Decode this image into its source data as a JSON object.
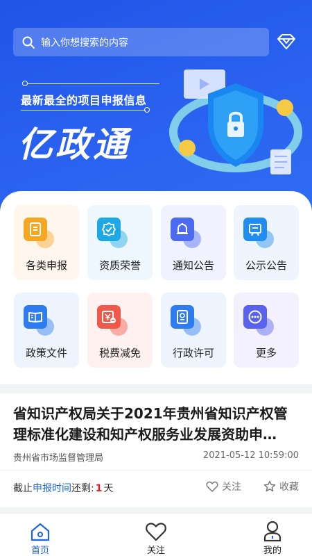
{
  "search": {
    "placeholder": "输入你想搜索的内容",
    "icon": "search-icon"
  },
  "header": {
    "vip_icon": "diamond-icon"
  },
  "banner": {
    "slogan": "最新最全的项目申报信息",
    "brand": "亿政通"
  },
  "grid": [
    {
      "label": "各类申报",
      "icon": "document-icon",
      "color": "#f5a623",
      "bg": "#fff7ee"
    },
    {
      "label": "资质荣誉",
      "icon": "badge-check-icon",
      "color": "#1ea8e6",
      "bg": "#eef6fe"
    },
    {
      "label": "通知公告",
      "icon": "bell-icon",
      "color": "#4d6bf0",
      "bg": "#f1f2ff"
    },
    {
      "label": "公示公告",
      "icon": "board-icon",
      "color": "#1f8ef0",
      "bg": "#eef5fe"
    },
    {
      "label": "政策文件",
      "icon": "book-icon",
      "color": "#2f7cf0",
      "bg": "#eef4fe"
    },
    {
      "label": "税费减免",
      "icon": "yen-icon",
      "color": "#f0584a",
      "bg": "#fff1ef"
    },
    {
      "label": "行政许可",
      "icon": "certificate-icon",
      "color": "#2f7cf0",
      "bg": "#eef4fe"
    },
    {
      "label": "更多",
      "icon": "more-icon",
      "color": "#5a63f0",
      "bg": "#f3f0ff"
    }
  ],
  "news": {
    "title": "省知识产权局关于2021年贵州省知识产权管理标准化建设和知产权服务业发展资助申…",
    "source": "贵州省市场监督管理局",
    "time": "2021-05-12  10:59:00",
    "deadline_prefix": "截止",
    "deadline_highlight": "申报时间",
    "deadline_middle": "还剩:",
    "deadline_days": "1",
    "deadline_unit": "天",
    "follow_label": "关注",
    "favorite_label": "收藏"
  },
  "tabs": [
    {
      "label": "首页",
      "icon": "home-icon",
      "active": true
    },
    {
      "label": "关注",
      "icon": "heart-icon",
      "active": false
    },
    {
      "label": "我的",
      "icon": "user-icon",
      "active": false
    }
  ],
  "colors": {
    "primary": "#1d64e6",
    "banner": "#2a62ef",
    "accent_red": "#e02020"
  }
}
